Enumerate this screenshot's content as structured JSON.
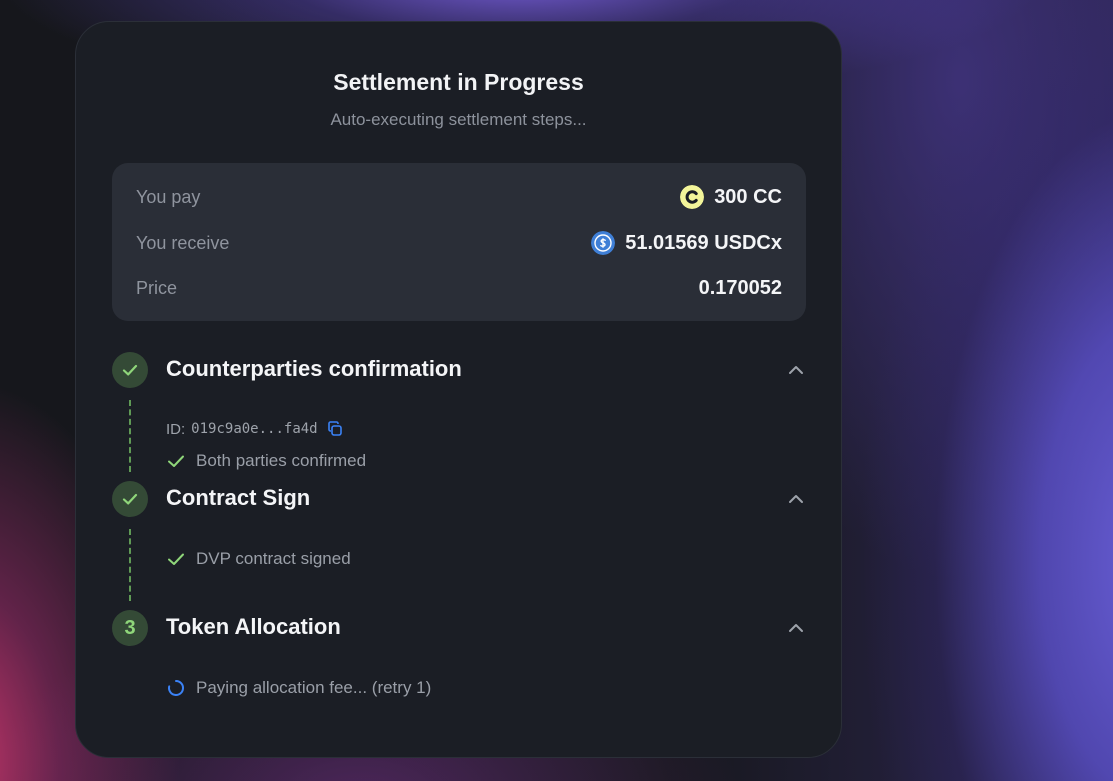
{
  "header": {
    "title": "Settlement in Progress",
    "subtitle": "Auto-executing settlement steps..."
  },
  "summary": {
    "pay": {
      "label": "You pay",
      "amount": "300 CC",
      "icon": "cc-coin-icon",
      "icon_color": "#f3f59a"
    },
    "receive": {
      "label": "You receive",
      "amount": "51.01569 USDCx",
      "icon": "usdc-coin-icon",
      "icon_color": "#3f7fd6"
    },
    "price": {
      "label": "Price",
      "value": "0.170052"
    }
  },
  "steps": [
    {
      "badge": "check-icon",
      "title": "Counterparties confirmation",
      "status": "done",
      "id_label": "ID:",
      "id_value": "019c9a0e...fa4d",
      "detail": "Both parties confirmed"
    },
    {
      "badge": "check-icon",
      "title": "Contract Sign",
      "status": "done",
      "detail": "DVP contract signed"
    },
    {
      "badge": "3",
      "title": "Token Allocation",
      "status": "in-progress",
      "detail": "Paying allocation fee... (retry 1)"
    }
  ],
  "colors": {
    "success": "#8fd67a",
    "badge_bg": "#344a36",
    "accent_blue": "#3b82f6",
    "card_bg": "#1b1e25",
    "summary_bg": "#2a2e37"
  }
}
